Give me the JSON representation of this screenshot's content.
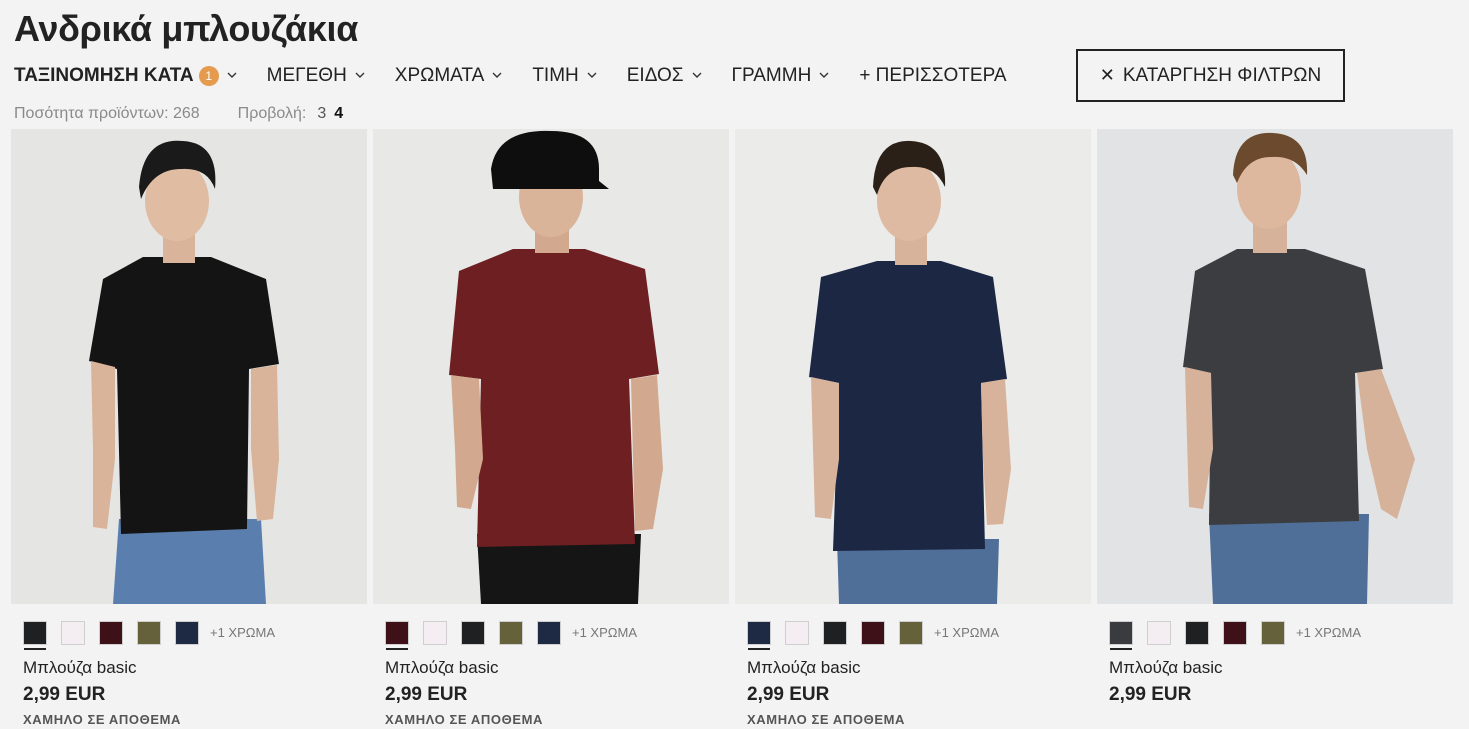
{
  "page_title": "Ανδρικά μπλουζάκια",
  "filters": [
    {
      "label": "ΤΑΞΙΝΟΜΗΣΗ ΚΑΤΑ",
      "badge": "1"
    },
    {
      "label": "ΜΕΓΕΘΗ"
    },
    {
      "label": "ΧΡΩΜΑΤΑ"
    },
    {
      "label": "ΤΙΜΗ"
    },
    {
      "label": "ΕΙΔΟΣ"
    },
    {
      "label": "ΓΡΑΜΜΗ"
    },
    {
      "label": "+ ΠΕΡΙΣΣΟΤΕΡΑ"
    }
  ],
  "clear_filters": "ΚΑΤΑΡΓΗΣΗ ΦΙΛΤΡΩΝ",
  "meta": {
    "count_label": "Ποσότητα προϊόντων: 268",
    "view_label": "Προβολή:",
    "view_options": [
      "3",
      "4"
    ],
    "view_active": "4"
  },
  "products": [
    {
      "name": "Μπλούζα basic",
      "price": "2,99 EUR",
      "stock": "ΧΑΜΗΛΟ ΣΕ ΑΠΟΘΕΜΑ",
      "more_colors": "+1 ΧΡΩΜΑ",
      "swatches": [
        "#1f2022",
        "#f4eef2",
        "#3e1119",
        "#65613a",
        "#1e2a44"
      ],
      "shirt_color": "#141414"
    },
    {
      "name": "Μπλούζα basic",
      "price": "2,99 EUR",
      "stock": "ΧΑΜΗΛΟ ΣΕ ΑΠΟΘΕΜΑ",
      "more_colors": "+1 ΧΡΩΜΑ",
      "swatches": [
        "#3e1119",
        "#f4eef2",
        "#1f2022",
        "#65613a",
        "#1e2a44"
      ],
      "shirt_color": "#6e1f22"
    },
    {
      "name": "Μπλούζα basic",
      "price": "2,99 EUR",
      "stock": "ΧΑΜΗΛΟ ΣΕ ΑΠΟΘΕΜΑ",
      "more_colors": "+1 ΧΡΩΜΑ",
      "swatches": [
        "#1e2a44",
        "#f4eef2",
        "#1f2022",
        "#3e1119",
        "#65613a"
      ],
      "shirt_color": "#1c2744"
    },
    {
      "name": "Μπλούζα basic",
      "price": "2,99 EUR",
      "stock": "",
      "more_colors": "+1 ΧΡΩΜΑ",
      "swatches": [
        "#3a3b3e",
        "#f4eef2",
        "#1f2022",
        "#3e1119",
        "#65613a"
      ],
      "shirt_color": "#3c3d40"
    }
  ]
}
